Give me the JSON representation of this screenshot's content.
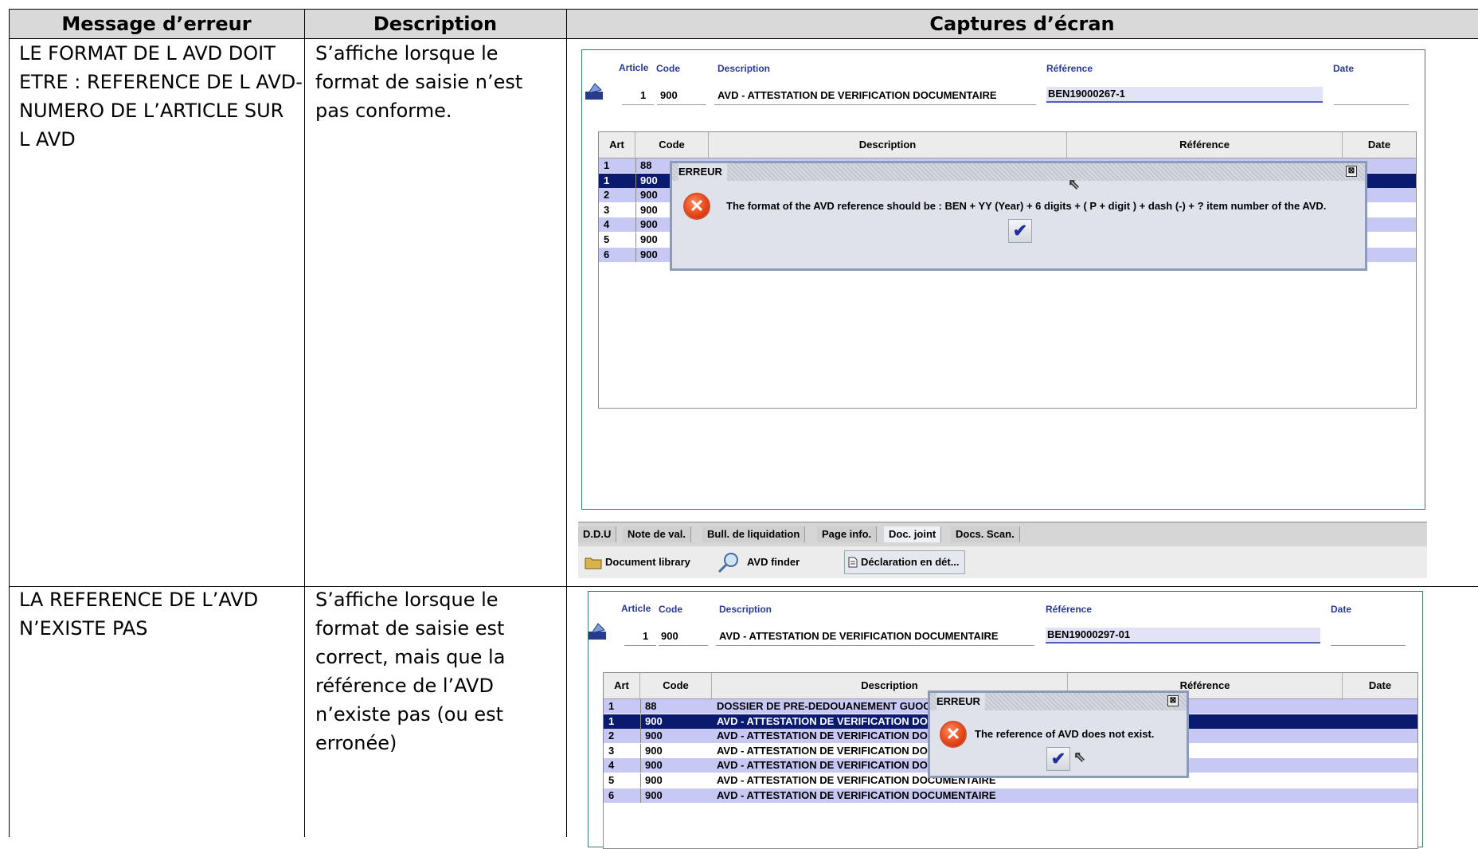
{
  "table": {
    "headers": [
      "Message d’erreur",
      "Description",
      "Captures d’écran"
    ],
    "rows": [
      {
        "message": [
          "LE FORMAT DE L AVD DOIT",
          "ETRE : REFERENCE DE L AVD-",
          "NUMERO DE L’ARTICLE SUR",
          "L AVD"
        ],
        "description": [
          "S’affiche lorsque le",
          "format de saisie n’est",
          "pas conforme."
        ]
      },
      {
        "message": [
          "LA REFERENCE DE L’AVD",
          "N’EXISTE PAS"
        ],
        "description": [
          "S’affiche lorsque le",
          "format de saisie est",
          "correct, mais que la",
          "référence de l’AVD",
          "n’existe pas (ou est",
          "erronée)"
        ]
      }
    ]
  },
  "shot1": {
    "labels": {
      "article": "Article",
      "code": "Code",
      "description": "Description",
      "reference": "Référence",
      "date": "Date"
    },
    "article_no": "1",
    "code": "900",
    "description": "AVD - ATTESTATION DE VERIFICATION DOCUMENTAIRE",
    "reference": "BEN19000267-1",
    "grid_headers": [
      "Art",
      "Code",
      "Description",
      "Référence",
      "Date"
    ],
    "grid_rows": [
      {
        "art": "1",
        "code": "88"
      },
      {
        "art": "1",
        "code": "900"
      },
      {
        "art": "2",
        "code": "900"
      },
      {
        "art": "3",
        "code": "900"
      },
      {
        "art": "4",
        "code": "900"
      },
      {
        "art": "5",
        "code": "900"
      },
      {
        "art": "6",
        "code": "900"
      }
    ],
    "dialog_title": "ERREUR",
    "dialog_message": "The format of the AVD reference should be : BEN + YY (Year) + 6 digits + ( P + digit ) + dash (-) + ? item number of the AVD.",
    "ok_glyph": "✔",
    "tabs": [
      "D.D.U",
      "Note de val.",
      "Bull. de liquidation",
      "Page info.",
      "Doc. joint",
      "Docs. Scan."
    ],
    "toolbar": [
      "Document library",
      "AVD finder",
      "Déclaration en dét..."
    ]
  },
  "shot2": {
    "labels": {
      "article": "Article",
      "code": "Code",
      "description": "Description",
      "reference": "Référence",
      "date": "Date"
    },
    "article_no": "1",
    "code": "900",
    "description": "AVD - ATTESTATION DE VERIFICATION DOCUMENTAIRE",
    "reference": "BEN19000297-01",
    "grid_headers": [
      "Art",
      "Code",
      "Description",
      "Référence",
      "Date"
    ],
    "grid_rows": [
      {
        "art": "1",
        "code": "88",
        "desc": "DOSSIER DE PRE-DEDOUANEMENT GUOCE"
      },
      {
        "art": "1",
        "code": "900",
        "desc": "AVD - ATTESTATION DE VERIFICATION DOCUMENTAIRE"
      },
      {
        "art": "2",
        "code": "900",
        "desc": "AVD - ATTESTATION DE VERIFICATION DOCUMENTAIRE"
      },
      {
        "art": "3",
        "code": "900",
        "desc": "AVD - ATTESTATION DE VERIFICATION DOCUMENTAIRE"
      },
      {
        "art": "4",
        "code": "900",
        "desc": "AVD - ATTESTATION DE VERIFICATION DOCUMENTAIRE"
      },
      {
        "art": "5",
        "code": "900",
        "desc": "AVD - ATTESTATION DE VERIFICATION DOCUMENTAIRE"
      },
      {
        "art": "6",
        "code": "900",
        "desc": "AVD - ATTESTATION DE VERIFICATION DOCUMENTAIRE"
      }
    ],
    "dialog_title": "ERREUR",
    "dialog_message": "The reference of AVD does not exist.",
    "ok_glyph": "✔"
  },
  "icons": {
    "error": "error-x-icon",
    "ok": "checkmark-icon",
    "cursor": "mouse-pointer-icon",
    "folder": "folder-icon",
    "finder": "magnifier-icon",
    "document": "document-icon",
    "arrow": "article-nav-icon"
  },
  "colors": {
    "selected_row": "#0a1a6e",
    "odd_row": "#c8c8f4",
    "label_blue": "#27399a",
    "header_bg": "#d9d9d9"
  }
}
